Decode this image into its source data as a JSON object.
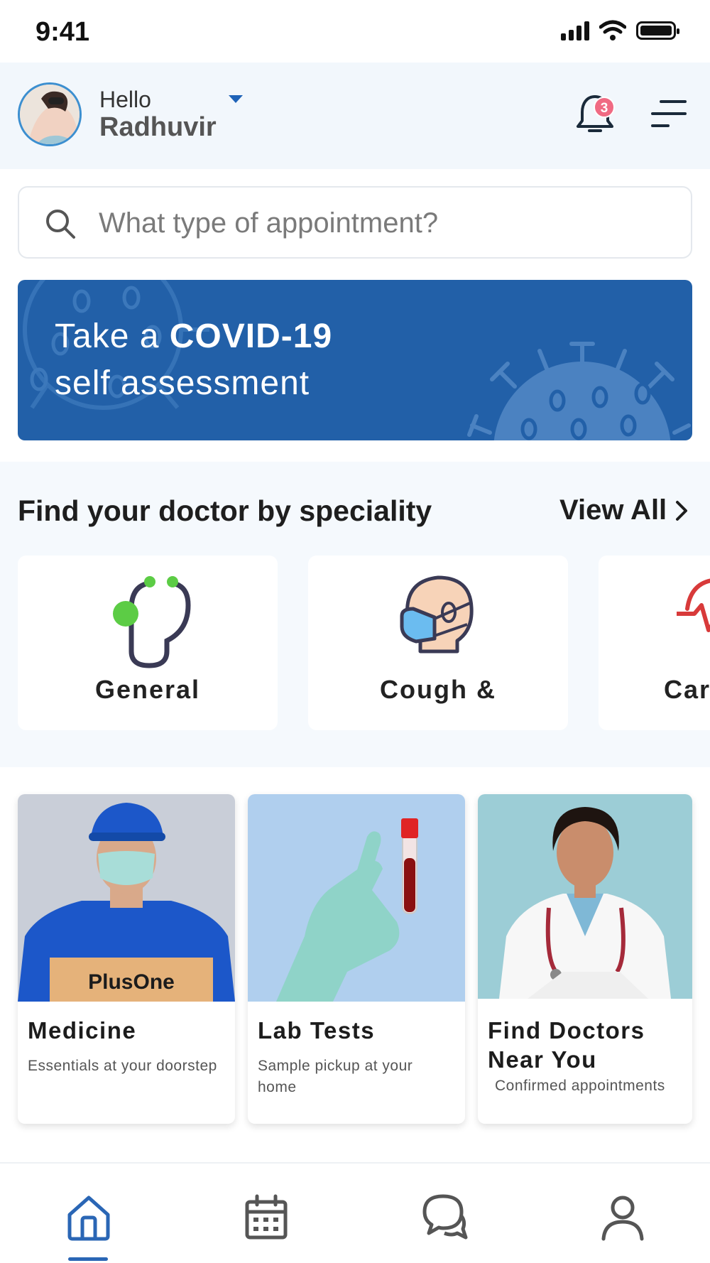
{
  "status_bar": {
    "time": "9:41"
  },
  "header": {
    "greeting": "Hello",
    "user_name": "Radhuvir",
    "notification_count": "3",
    "icons": [
      "avatar",
      "chevron-down-icon",
      "bell-icon",
      "menu-icon"
    ]
  },
  "search": {
    "placeholder": "What type of appointment?",
    "value": ""
  },
  "banner": {
    "line1_prefix": "Take a ",
    "line1_bold": "COVID-19",
    "line2": "self assessment",
    "color": "#2260a8"
  },
  "specialities": {
    "title": "Find your doctor by speciality",
    "view_all": "View All",
    "items": [
      {
        "label": "General",
        "icon": "stethoscope-icon"
      },
      {
        "label": "Cough &",
        "icon": "mask-face-icon"
      },
      {
        "label": "Card",
        "icon": "heart-pulse-icon"
      }
    ]
  },
  "services": [
    {
      "title": "Medicine",
      "subtitle": "Essentials at your doorstep",
      "image": "delivery-man-with-box",
      "box_text": "PlusOne"
    },
    {
      "title": "Lab Tests",
      "subtitle": "Sample pickup at your home",
      "image": "gloved-hand-with-blood-tube"
    },
    {
      "title": "Find Doctors Near You",
      "subtitle": "Confirmed appointments",
      "image": "smiling-doctor"
    }
  ],
  "bottom_nav": {
    "items": [
      "home-icon",
      "calendar-icon",
      "chat-icon",
      "profile-icon"
    ],
    "active": "home-icon",
    "accent": "#2a66b5"
  }
}
